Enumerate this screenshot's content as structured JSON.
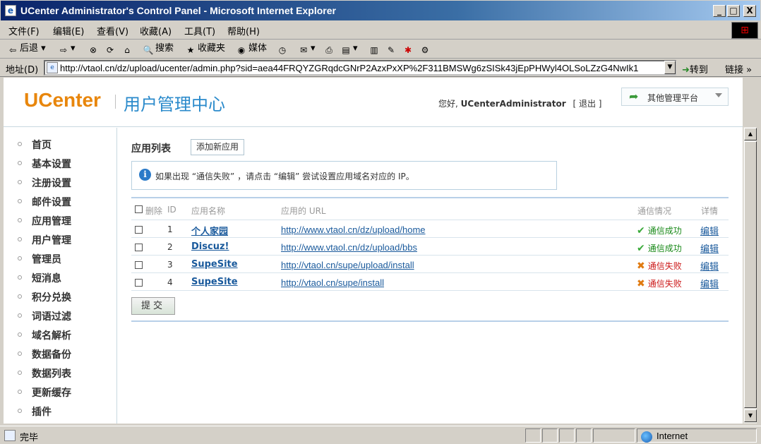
{
  "window": {
    "title": "UCenter Administrator's Control Panel - Microsoft Internet Explorer",
    "min_label": "_",
    "max_label": "□",
    "close_label": "X"
  },
  "menubar": [
    "文件(F)",
    "编辑(E)",
    "查看(V)",
    "收藏(A)",
    "工具(T)",
    "帮助(H)"
  ],
  "toolbar": {
    "back": "后退",
    "search": "搜索",
    "favorites": "收藏夹",
    "media": "媒体"
  },
  "address": {
    "label": "地址(D)",
    "url": "http://vtaol.cn/dz/upload/ucenter/admin.php?sid=aea44FRQYZGRqdcGNrP2AzxPxXP%2F311BMSWg6zSISk43jEpPHWyl4OLSoLZzG4NwIk1",
    "go": "转到",
    "links": "链接"
  },
  "header": {
    "logo": "UCenter",
    "logo_cn": "用户管理中心",
    "greeting_prefix": "您好,",
    "username": "UCenterAdministrator",
    "logout": "[ 退出 ]",
    "other_platform": "其他管理平台"
  },
  "sidebar": {
    "items": [
      {
        "label": "首页"
      },
      {
        "label": "基本设置"
      },
      {
        "label": "注册设置"
      },
      {
        "label": "邮件设置"
      },
      {
        "label": "应用管理"
      },
      {
        "label": "用户管理"
      },
      {
        "label": "管理员"
      },
      {
        "label": "短消息"
      },
      {
        "label": "积分兑换"
      },
      {
        "label": "词语过滤"
      },
      {
        "label": "域名解析"
      },
      {
        "label": "数据备份"
      },
      {
        "label": "数据列表"
      },
      {
        "label": "更新缓存"
      },
      {
        "label": "插件"
      }
    ]
  },
  "main": {
    "title": "应用列表",
    "add_button": "添加新应用",
    "notice": "如果出现 “通信失败” ，请点击 “编辑” 尝试设置应用域名对应的 IP。",
    "columns": {
      "delete": "删除",
      "id": "ID",
      "name": "应用名称",
      "url": "应用的 URL",
      "status": "通信情况",
      "detail": "详情"
    },
    "rows": [
      {
        "id": "1",
        "name": "个人家园",
        "url": "http://www.vtaol.cn/dz/upload/home",
        "status": "通信成功",
        "ok": true,
        "edit": "编辑"
      },
      {
        "id": "2",
        "name": "Discuz!",
        "url": "http://www.vtaol.cn/dz/upload/bbs",
        "status": "通信成功",
        "ok": true,
        "edit": "编辑"
      },
      {
        "id": "3",
        "name": "SupeSite",
        "url": "http://vtaol.cn/supe/upload/install",
        "status": "通信失败",
        "ok": false,
        "edit": "编辑"
      },
      {
        "id": "4",
        "name": "SupeSite",
        "url": "http://vtaol.cn/supe/install",
        "status": "通信失败",
        "ok": false,
        "edit": "编辑"
      }
    ],
    "submit": "提交"
  },
  "statusbar": {
    "text": "完毕",
    "zone": "Internet"
  },
  "colors": {
    "title_gradient_start": "#0a246a",
    "logo_orange": "#e8860c",
    "logo_blue": "#2a8acb",
    "link": "#1a5a9c",
    "ok": "#1a8a1a",
    "fail": "#cc1a1a"
  }
}
